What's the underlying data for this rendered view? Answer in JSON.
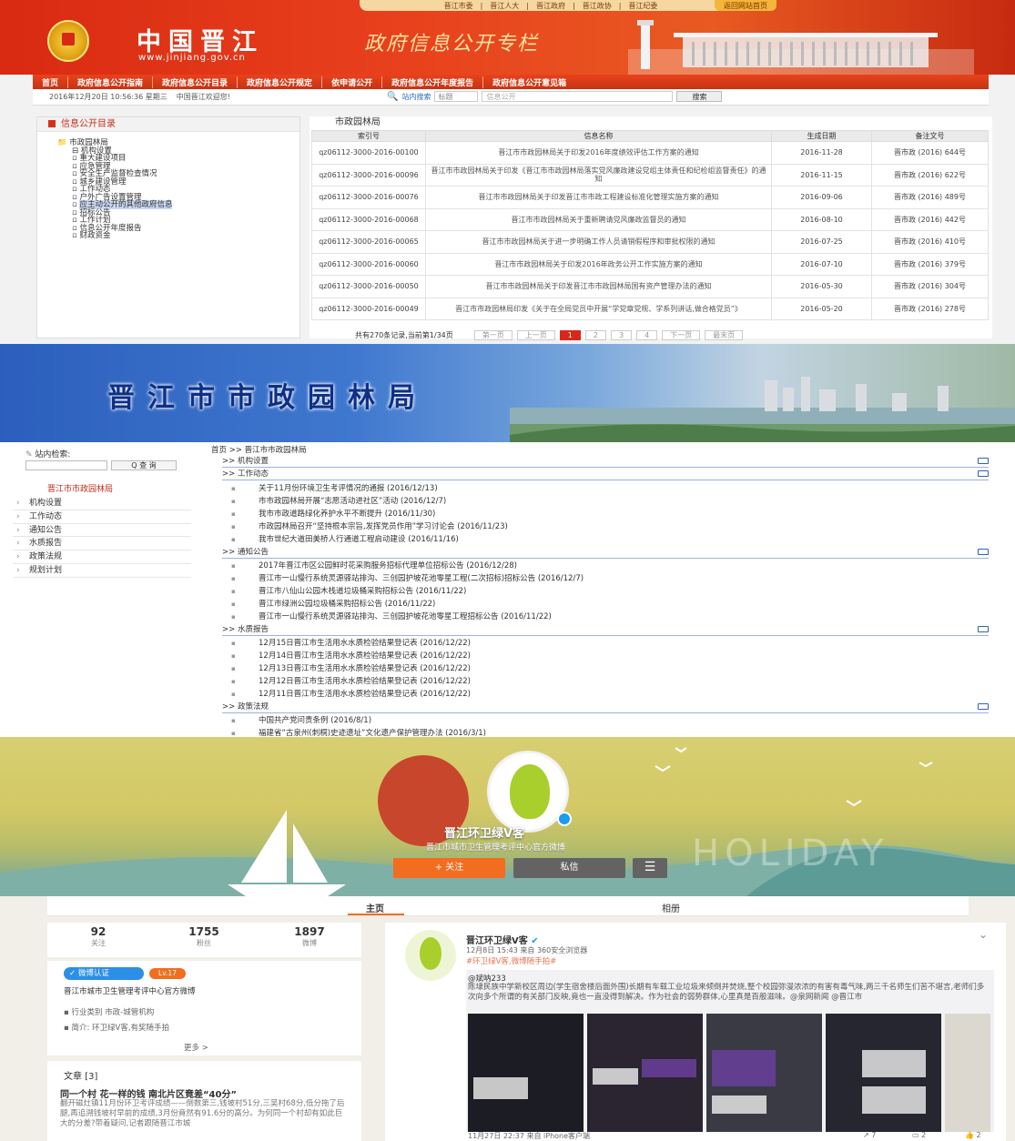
{
  "portal": {
    "top_links": [
      "晋江市委",
      "晋江人大",
      "晋江政府",
      "晋江政协",
      "晋江纪委"
    ],
    "return_home": "返回网站首页",
    "site_name": "中国晋江",
    "site_url": "www.jinjiang.gov.cn",
    "slogan": "政府信息公开专栏",
    "nav": [
      "首页",
      "政府信息公开指南",
      "政府信息公开目录",
      "政府信息公开规定",
      "依申请公开",
      "政府信息公开年度报告",
      "政府信息公开意见箱"
    ],
    "datetime": "2016年12月20日 10:56:36 星期三",
    "welcome": "中国晋江欢迎您!",
    "search_label": "站内搜索",
    "search_field": "标题",
    "search_placeholder": "信息公开",
    "search_button": "搜索",
    "catalog_title": "信息公开目录",
    "tree_root": "市政园林局",
    "tree_group": "机构设置",
    "tree_items": [
      "重大建设项目",
      "应急管理",
      "安全生产监督检查情况",
      "城乡建设管理",
      "工作动态",
      "户外广告设置管理",
      "应主动公开的其他政府信息",
      "招标公告",
      "工作计划",
      "信息公开年度报告",
      "财政资金"
    ],
    "panel_title": "市政园林局",
    "table_headers": [
      "索引号",
      "信息名称",
      "生成日期",
      "备注文号"
    ],
    "table_rows": [
      {
        "index": "qz06112-3000-2016-00100",
        "name": "晋江市市政园林局关于印发2016年度绩效评估工作方案的通知",
        "date": "2016-11-28",
        "doc": "晋市政 (2016) 644号"
      },
      {
        "index": "qz06112-3000-2016-00096",
        "name": "晋江市市政园林局关于印发《晋江市市政园林局落实党风廉政建设党组主体责任和纪检组监督责任》的通知",
        "date": "2016-11-15",
        "doc": "晋市政 (2016) 622号"
      },
      {
        "index": "qz06112-3000-2016-00076",
        "name": "晋江市市政园林局关于印发晋江市市政工程建设标准化管理实施方案的通知",
        "date": "2016-09-06",
        "doc": "晋市政 (2016) 489号"
      },
      {
        "index": "qz06112-3000-2016-00068",
        "name": "晋江市市政园林局关于重新聘请党风廉政监督员的通知",
        "date": "2016-08-10",
        "doc": "晋市政 (2016) 442号"
      },
      {
        "index": "qz06112-3000-2016-00065",
        "name": "晋江市市政园林局关于进一步明确工作人员请销假程序和审批权限的通知",
        "date": "2016-07-25",
        "doc": "晋市政 (2016) 410号"
      },
      {
        "index": "qz06112-3000-2016-00060",
        "name": "晋江市市政园林局关于印发2016年政务公开工作实施方案的通知",
        "date": "2016-07-10",
        "doc": "晋市政 (2016) 379号"
      },
      {
        "index": "qz06112-3000-2016-00050",
        "name": "晋江市市政园林局关于印发晋江市市政园林局国有资产管理办法的通知",
        "date": "2016-05-30",
        "doc": "晋市政 (2016) 304号"
      },
      {
        "index": "qz06112-3000-2016-00049",
        "name": "晋江市市政园林局印发《关于在全局党员中开展“学党章党规、学系列讲话,做合格党员”》",
        "date": "2016-05-20",
        "doc": "晋市政 (2016) 278号"
      }
    ],
    "pager_summary": "共有270条记录,当前第1/34页",
    "pager_buttons": [
      "第一页",
      "上一页",
      "1",
      "2",
      "3",
      "4",
      "下一页",
      "最末页"
    ]
  },
  "bureau": {
    "banner_title": "晋江市市政园林局",
    "search_label": "站内检索:",
    "search_button": "Q 查 询",
    "sidebar_title": "晋江市市政园林局",
    "menu": [
      "机构设置",
      "工作动态",
      "通知公告",
      "水质报告",
      "政策法规",
      "规划计划"
    ],
    "breadcrumb": "首页 >> 晋江市市政园林局",
    "sections": [
      {
        "title": ">> 机构设置",
        "items": []
      },
      {
        "title": ">> 工作动态",
        "items": [
          "关于11月份环境卫生考评情况的通报 (2016/12/13)",
          "市市政园林局开展“志愿活动进社区”活动 (2016/12/7)",
          "我市市政道路绿化养护水平不断提升 (2016/11/30)",
          "市政园林局召开“坚持根本宗旨,发挥党员作用”学习讨论会 (2016/11/23)",
          "我市世纪大道田美桥人行通道工程启动建设 (2016/11/16)"
        ]
      },
      {
        "title": ">> 通知公告",
        "items": [
          "2017年晋江市区公园鲜时花采购服务招标代理单位招标公告 (2016/12/28)",
          "晋江市一山慢行系统灵源驿站排沟、三创园护坡花池零星工程(二次招标)招标公告 (2016/12/7)",
          "晋江市八仙山公园木栈道垃圾桶采购招标公告 (2016/11/22)",
          "晋江市绿洲公园垃圾桶采购招标公告 (2016/11/22)",
          "晋江市一山慢行系统灵源驿站排沟、三创园护坡花池零星工程招标公告 (2016/11/22)"
        ]
      },
      {
        "title": ">> 水质报告",
        "items": [
          "12月15日晋江市生活用水水质检验结果登记表 (2016/12/22)",
          "12月14日晋江市生活用水水质检验结果登记表 (2016/12/22)",
          "12月13日晋江市生活用水水质检验结果登记表 (2016/12/22)",
          "12月12日晋江市生活用水水质检验结果登记表 (2016/12/22)",
          "12月11日晋江市生活用水水质检验结果登记表 (2016/12/22)"
        ]
      },
      {
        "title": ">> 政策法规",
        "items": [
          "中国共产党问责条例 (2016/8/1)",
          "福建省“古泉州(刺桐)史迹遗址”文化遗产保护管理办法 (2016/3/1)"
        ]
      }
    ]
  },
  "weibo": {
    "name": "晋江环卫绿V客",
    "desc": "晋江市城市卫生管理考评中心官方微博",
    "follow": "+ 关注",
    "message": "私信",
    "menu_glyph": "☰",
    "watermark": "HOLIDAY",
    "tabs": [
      "主页",
      "相册"
    ],
    "stats": [
      {
        "value": "92",
        "label": "关注"
      },
      {
        "value": "1755",
        "label": "粉丝"
      },
      {
        "value": "1897",
        "label": "微博"
      }
    ],
    "cert_badge": "微博认证",
    "level_badge": "Lv.17",
    "cert_desc": "晋江市城市卫生管理考评中心官方微博",
    "industry": "行业类别 市政-城管机构",
    "intro": "简介: 环卫绿V客,有奖随手拍",
    "more": "更多 >",
    "articles_title": "文章 [3]",
    "article_headline": "同一个村 花一样的钱 南北片区竟差“40分”",
    "article_body": "翻开磁灶镇11月份环卫考评成绩——倒数第三,钱坡村51分,三吴村68分,低分拖了后腿,再追溯钱坡村早前的成绩,3月份竟然有91.6分的高分。为何同一个村却有如此巨大的分差?带着疑问,记者跟随晋江市城",
    "post_author": "晋江环卫绿V客",
    "post_time": "12月8日 15:43 来自 360安全浏览器",
    "post_tags": "#环卫绿V客,微博随手拍#",
    "post_mention": "@斌呐233",
    "post_text": "陈埭民族中学新校区周边(学生宿舍楼后面外围)长期有车载工业垃圾来倾倒并焚烧,整个校园弥漫浓浓的有害有毒气味,两三千名师生们苦不堪言,老师们多次向多个所谓的有关部门反映,竟也一直没得到解决。作为社会的弱势群体,心里真是百般滋味。@泉网新闻 @晋江市",
    "repost_time": "11月27日 22:37 来自 iPhone客户端",
    "actions": {
      "repost": "7",
      "comment": "2",
      "like": "2"
    }
  }
}
